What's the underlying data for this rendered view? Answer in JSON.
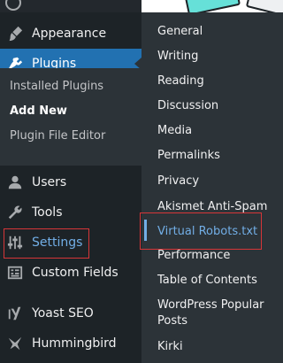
{
  "sidebar": {
    "items": [
      {
        "key": "appearance",
        "label": "Appearance",
        "icon": "paintbrush-icon"
      },
      {
        "key": "plugins",
        "label": "Plugins",
        "icon": "plug-icon"
      },
      {
        "key": "users",
        "label": "Users",
        "icon": "user-icon"
      },
      {
        "key": "tools",
        "label": "Tools",
        "icon": "wrench-icon"
      },
      {
        "key": "settings",
        "label": "Settings",
        "icon": "sliders-icon"
      },
      {
        "key": "custom_fields",
        "label": "Custom Fields",
        "icon": "grid-icon"
      },
      {
        "key": "yoast",
        "label": "Yoast SEO",
        "icon": "yoast-icon"
      },
      {
        "key": "hummingbird",
        "label": "Hummingbird",
        "icon": "hummingbird-icon"
      }
    ],
    "plugins_submenu": [
      {
        "label": "Installed Plugins"
      },
      {
        "label": "Add New"
      },
      {
        "label": "Plugin File Editor"
      }
    ]
  },
  "settings_flyout": {
    "items": [
      {
        "label": "General"
      },
      {
        "label": "Writing"
      },
      {
        "label": "Reading"
      },
      {
        "label": "Discussion"
      },
      {
        "label": "Media"
      },
      {
        "label": "Permalinks"
      },
      {
        "label": "Privacy"
      },
      {
        "label": "Akismet Anti-Spam"
      },
      {
        "label": "Virtual Robots.txt"
      },
      {
        "label": "Performance"
      },
      {
        "label": "Table of Contents"
      },
      {
        "label": "WordPress Popular Posts"
      },
      {
        "label": "Kirki"
      }
    ]
  },
  "colors": {
    "sidebar_bg": "#1d2327",
    "submenu_bg": "#2c3338",
    "active_bg": "#2271b1",
    "current_link": "#72aee6",
    "highlight_border": "#d63638"
  }
}
